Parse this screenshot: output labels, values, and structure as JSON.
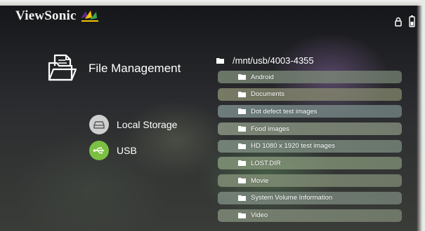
{
  "brand": {
    "name": "ViewSonic",
    "colors": {
      "purple": "#5b2a86",
      "yellow": "#f2c400",
      "green": "#3aa648"
    }
  },
  "status": {
    "icons": [
      "lock-icon",
      "battery-icon"
    ]
  },
  "header": {
    "title": "File Management",
    "icon": "folder-documents-icon"
  },
  "sources": [
    {
      "label": "Local Storage",
      "icon": "hard-drive-icon",
      "color": "#cfcfcf"
    },
    {
      "label": "USB",
      "icon": "usb-icon",
      "color": "#7bc043"
    }
  ],
  "browser": {
    "current_path": "/mnt/usb/4003-4355",
    "folders": [
      {
        "label": "Android",
        "tint": "#7c8a78"
      },
      {
        "label": "Documents",
        "tint": "#8a8d72"
      },
      {
        "label": "Dot defect test images",
        "tint": "#7d8f8e"
      },
      {
        "label": "Food images",
        "tint": "#8e9a86"
      },
      {
        "label": "HD 1080 x 1920 test images",
        "tint": "#829486"
      },
      {
        "label": "LOST.DIR",
        "tint": "#889a7c"
      },
      {
        "label": "Movie",
        "tint": "#86927a"
      },
      {
        "label": "System Volume Information",
        "tint": "#7f8d82"
      },
      {
        "label": "Video",
        "tint": "#848f7c"
      }
    ]
  }
}
